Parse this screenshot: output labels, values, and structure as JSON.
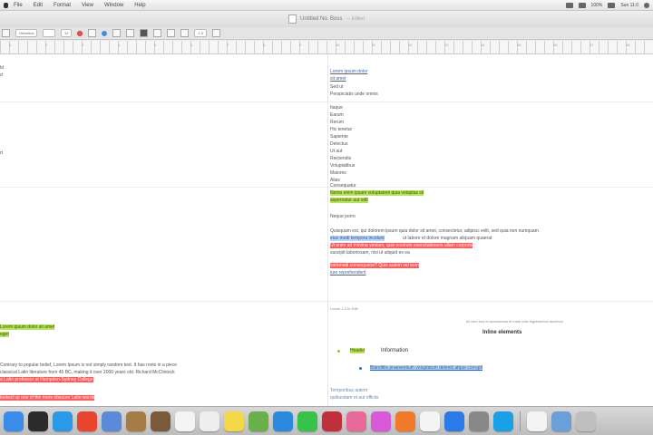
{
  "menubar": {
    "items": [
      "File",
      "Edit",
      "Format",
      "View",
      "Window",
      "Help"
    ],
    "right": [
      "100%",
      "Sun 11:0"
    ]
  },
  "window": {
    "title": "Untitled No. Boss",
    "edited": "— Edited"
  },
  "toolbar": {
    "style": "Helvetica",
    "size": "12",
    "spacing": "1.0"
  },
  "ruler": {
    "ticks": [
      "1",
      "2",
      "3",
      "4",
      "5",
      "6",
      "7",
      "8",
      "9",
      "10",
      "11",
      "12",
      "13",
      "14",
      "15",
      "16",
      "17",
      "18"
    ]
  },
  "left": {
    "top_lines": [
      "ld",
      "d"
    ],
    "mid_line": "rt",
    "green_1": "Lorem ipsum dolor sit amet",
    "green_2": "eget",
    "bottom_1": "Contrary to popular belief, Lorem Ipsum is not simply random text. It has roots in a piece",
    "bottom_2": "classical Latin literature from 45 BC, making it over 2000 years old. Richard McClintock",
    "red_1": "a Latin professor at Hampden-Sydney College",
    "red_2": "looked up one of the more obscure Latin words"
  },
  "right": {
    "link_1": "Lorem ipsum dolor",
    "link_2": "sit amet",
    "text_1": "Sed ut",
    "text_2": "Perspiciatis unde omnis",
    "list": [
      "Itaque",
      "Earum",
      "Rerum",
      "Hic tenetur",
      "Sapiente",
      "Delectus",
      "Ut aut",
      "Reiciendis",
      "Voluptatibus",
      "Maiores",
      "Alias",
      "Consequatur",
      "Aut perferendis"
    ],
    "green_1": "Nemo enim ipsam voluptatem quia voluptas sit",
    "green_2": "aspernatur aut odit",
    "label": "Neque porro",
    "para_1": "Quisquam est, qui dolorem ipsum quia dolor sit amet, consectetur, adipisci velit, sed quia non numquam",
    "blue_hl": "eius modi tempora incidunt",
    "para_1b": "ut labore et dolore magnam aliquam quaerat",
    "red_1": "Ut enim ad minima veniam, quis nostrum exercitationem ullam corporis",
    "para_2": "suscipit laboriosam, nisi ut aliquid ex ea",
    "red_2": "commodi consequatur? Quis autem vel eum",
    "link_3": "iure reprehenderit",
    "note": "Lorem 1.2 fn Edit",
    "center_note": "At vero eos et accusamus et iusto odio dignissimos ducimus",
    "heading": "Inline elements",
    "bullet_1_green": "Header",
    "bullet_1_text": "Information",
    "bullet_2_link": "Blanditiis praesentium voluptatum deleniti atque corrupti",
    "footer_1": "Temporibus autem",
    "footer_2": "quibusdam et aut officiis"
  },
  "dock": {
    "icons": [
      {
        "name": "finder-icon",
        "color": "#3b8be8"
      },
      {
        "name": "activity-icon",
        "color": "#2b2b2b"
      },
      {
        "name": "safari-icon",
        "color": "#2a9ae8"
      },
      {
        "name": "chrome-icon",
        "color": "#e8452c"
      },
      {
        "name": "preview-icon",
        "color": "#5a8ad8"
      },
      {
        "name": "notes-brown-icon",
        "color": "#a67c45"
      },
      {
        "name": "tree-icon",
        "color": "#7a5a3a"
      },
      {
        "name": "calendar-icon",
        "color": "#f4f4f4"
      },
      {
        "name": "document-icon",
        "color": "#eeeeee"
      },
      {
        "name": "notes-icon",
        "color": "#f5d84a"
      },
      {
        "name": "maps-icon",
        "color": "#6ab04a"
      },
      {
        "name": "photos-icon",
        "color": "#2a8ae0"
      },
      {
        "name": "messages-icon",
        "color": "#37c24a"
      },
      {
        "name": "photo-booth-icon",
        "color": "#c0303a"
      },
      {
        "name": "photos-color-icon",
        "color": "#e86a9a"
      },
      {
        "name": "itunes-icon",
        "color": "#d85ad8"
      },
      {
        "name": "books-icon",
        "color": "#f07a2a"
      },
      {
        "name": "textedit-icon",
        "color": "#f4f4f4"
      },
      {
        "name": "app-store-icon",
        "color": "#2a7ae8"
      },
      {
        "name": "settings-icon",
        "color": "#888888"
      },
      {
        "name": "skype-icon",
        "color": "#1aa0e8"
      },
      {
        "name": "stack-doc-icon",
        "color": "#f4f4f4"
      },
      {
        "name": "stack-folder-icon",
        "color": "#6aa0d8"
      },
      {
        "name": "trash-icon",
        "color": "#bfbfbf"
      }
    ]
  }
}
